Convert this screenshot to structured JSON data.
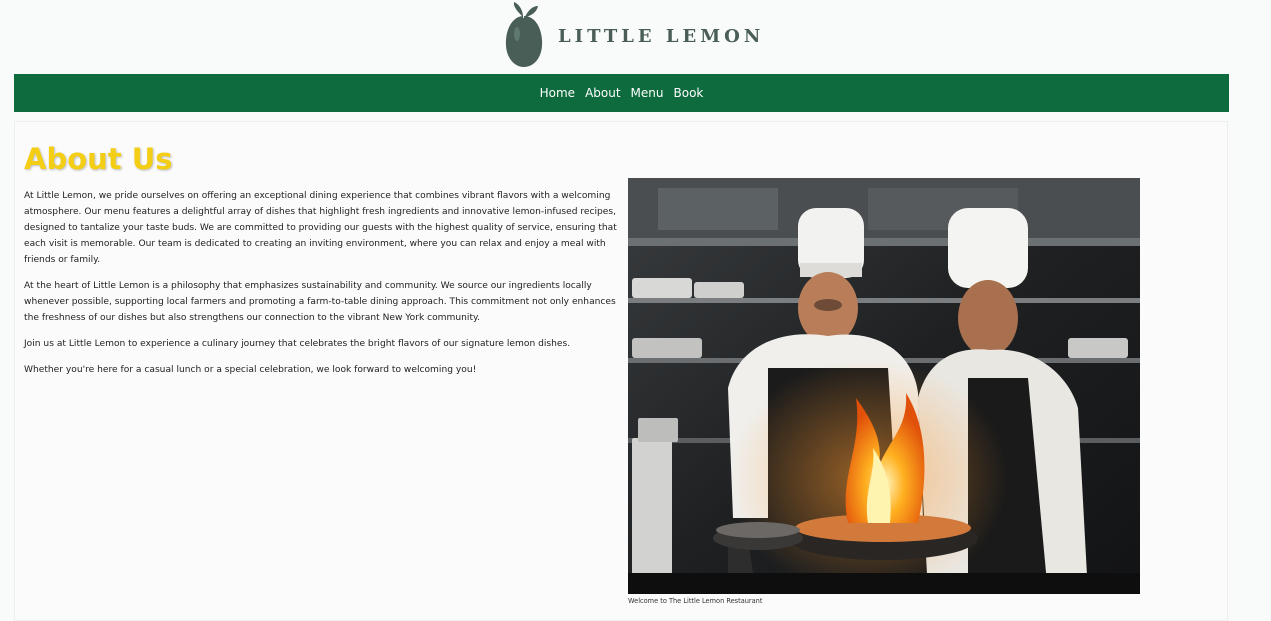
{
  "brand": {
    "name": "LITTLE LEMON",
    "logo_color": "#495e57",
    "icon": "lemon-logo-icon"
  },
  "nav": {
    "items": [
      {
        "label": "Home"
      },
      {
        "label": "About"
      },
      {
        "label": "Menu"
      },
      {
        "label": "Book"
      }
    ],
    "background": "#0e6b3e"
  },
  "about": {
    "title": "About Us",
    "title_color": "#f4ce14",
    "paragraphs": [
      "At Little Lemon, we pride ourselves on offering an exceptional dining experience that combines vibrant flavors with a welcoming atmosphere. Our menu features a delightful array of dishes that highlight fresh ingredients and innovative lemon-infused recipes, designed to tantalize your taste buds. We are committed to providing our guests with the highest quality of service, ensuring that each visit is memorable. Our team is dedicated to creating an inviting environment, where you can relax and enjoy a meal with friends or family.",
      "At the heart of Little Lemon is a philosophy that emphasizes sustainability and community. We source our ingredients locally whenever possible, supporting local farmers and promoting a farm-to-table dining approach. This commitment not only enhances the freshness of our dishes but also strengthens our connection to the vibrant New York community.",
      "Join us at Little Lemon to experience a culinary journey that celebrates the bright flavors of our signature lemon dishes.",
      "Whether you're here for a casual lunch or a special celebration, we look forward to welcoming you!"
    ],
    "image_caption": "Welcome to The Little Lemon Restaurant"
  }
}
